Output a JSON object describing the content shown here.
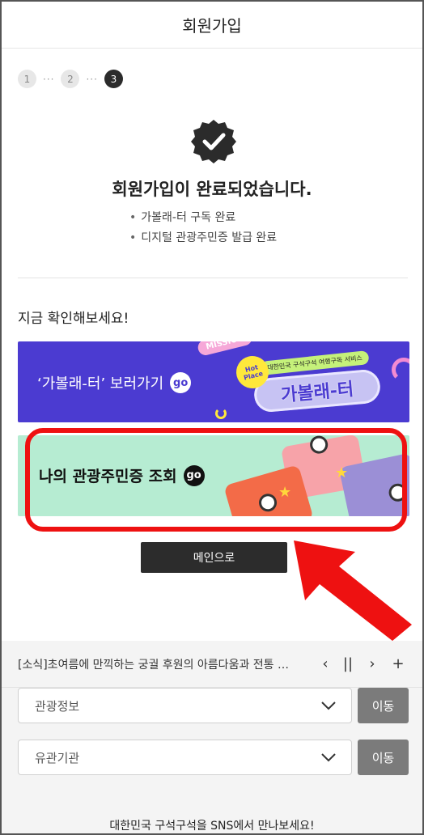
{
  "header": {
    "title": "회원가입"
  },
  "steps": [
    {
      "number": "1",
      "state": "done"
    },
    {
      "number": "2",
      "state": "done"
    },
    {
      "number": "3",
      "state": "active"
    }
  ],
  "step_separator": "···",
  "completion": {
    "title": "회원가입이 완료되었습니다.",
    "bullets": [
      "가볼래-터 구독 완료",
      "디지털 관광주민증 발급 완료"
    ]
  },
  "check_section": {
    "title": "지금 확인해보세요!"
  },
  "banners": [
    {
      "label": "‘가볼래-터’ 보러가기",
      "go": "go",
      "art": {
        "mission": "MISSION",
        "hot": "Hot Place",
        "service": "대한민국 구석구석 여행구독 서비스",
        "brand": "가볼래-터"
      },
      "bg_color": "#4b3bd1"
    },
    {
      "label": "나의 관광주민증 조회",
      "go": "go",
      "bg_color": "#b6ecd2"
    }
  ],
  "main_button": {
    "label": "메인으로"
  },
  "annotation": {
    "highlight_color": "#ee1111",
    "arrow_color": "#ee1111"
  },
  "news": {
    "text": "[소식]초여름에 만끽하는 궁궐 후원의 아름다움과 전통 …",
    "prev_icon": "chevron-left-icon",
    "pause_icon": "pause-icon",
    "next_icon": "chevron-right-icon",
    "more_icon": "plus-icon"
  },
  "selects": [
    {
      "value": "관광정보",
      "button": "이동"
    },
    {
      "value": "유관기관",
      "button": "이동"
    }
  ],
  "footer": {
    "sns_text": "대한민국 구석구석을 SNS에서 만나보세요!"
  }
}
